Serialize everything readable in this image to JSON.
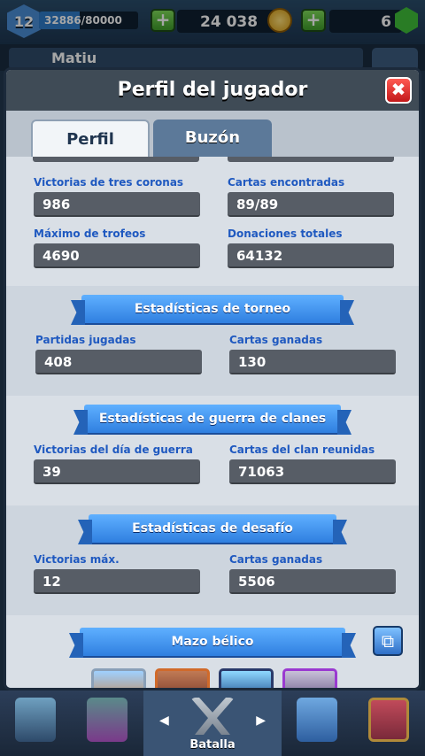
{
  "topbar": {
    "level": "12",
    "xp_text": "32886/80000",
    "xp_fraction": 0.41,
    "gold": "24 038",
    "gems": "6",
    "plus_icon": "plus-icon"
  },
  "profile_bar": {
    "player_name": "Matiu"
  },
  "panel": {
    "title": "Perfil del jugador",
    "close_icon": "close-icon"
  },
  "tabs": [
    {
      "label": "Perfil",
      "active": true
    },
    {
      "label": "Buzón",
      "active": false
    }
  ],
  "general_stats": [
    {
      "label": "Victorias de tres coronas",
      "value": "986"
    },
    {
      "label": "Cartas encontradas",
      "value": "89/89"
    },
    {
      "label": "Máximo de trofeos",
      "value": "4690"
    },
    {
      "label": "Donaciones totales",
      "value": "64132"
    }
  ],
  "sections": [
    {
      "title": "Estadísticas de torneo",
      "stats": [
        {
          "label": "Partidas jugadas",
          "value": "408"
        },
        {
          "label": "Cartas ganadas",
          "value": "130"
        }
      ]
    },
    {
      "title": "Estadísticas de guerra de clanes",
      "stats": [
        {
          "label": "Victorias del día de guerra",
          "value": "39"
        },
        {
          "label": "Cartas del clan reunidas",
          "value": "71063"
        }
      ]
    },
    {
      "title": "Estadísticas de desafío",
      "stats": [
        {
          "label": "Victorias máx.",
          "value": "12"
        },
        {
          "label": "Cartas ganadas",
          "value": "5506"
        }
      ]
    }
  ],
  "war_deck": {
    "title": "Mazo bélico",
    "copy_icon": "copy-deck-icon"
  },
  "bottom_nav": {
    "battle_label": "Batalla"
  },
  "colors": {
    "label_blue": "#1f59c0",
    "banner_blue": "#2f7fe0",
    "value_box": "#575d66",
    "panel_bg": "#d9dfe6"
  }
}
